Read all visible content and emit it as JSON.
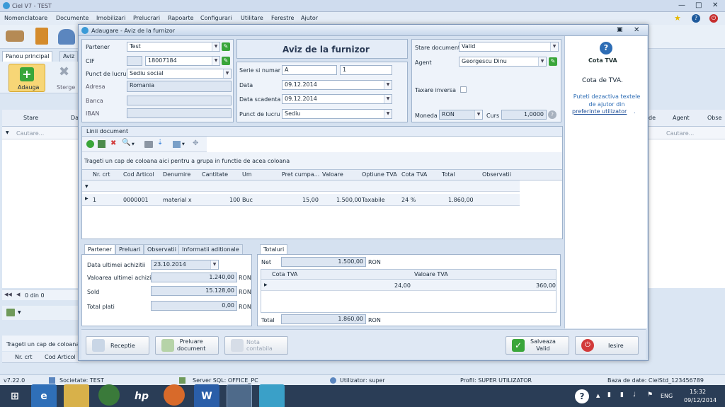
{
  "app": {
    "title": "Ciel V7 - TEST",
    "menu": [
      "Nomenclatoare",
      "Documente",
      "Imobilizari",
      "Prelucrari",
      "Rapoarte",
      "Configurari",
      "Utilitare",
      "Ferestre",
      "Ajutor"
    ]
  },
  "bg": {
    "tabs": [
      "Panou principal",
      "Aviz"
    ],
    "add_label": "Adauga",
    "delete_label": "Sterge",
    "col_stare": "Stare",
    "col_da": "Da",
    "search": "Cautare...",
    "col_agent": "Agent",
    "col_obse": "Obse",
    "search2": "Cautare...",
    "nav": "0 din 0",
    "group_hint": "Trageti un cap de coloana a",
    "col_nr": "Nr. crt",
    "col_cod": "Cod Articol"
  },
  "dialog": {
    "title": "Adaugare - Aviz de la furnizor",
    "heading": "Aviz de la furnizor",
    "partener_label": "Partener",
    "partener": "Test",
    "cif_label": "CIF",
    "cif": "18007184",
    "punct_label": "Punct de lucru",
    "punct": "Sediu social",
    "adresa_label": "Adresa",
    "adresa": "Romania",
    "banca_label": "Banca",
    "iban_label": "IBAN",
    "serie_label": "Serie si numar",
    "serie": "A",
    "numar": "1",
    "data_label": "Data",
    "data": "09.12.2014",
    "scad_label": "Data scadenta",
    "scad": "09.12.2014",
    "punct2_label": "Punct de lucru",
    "punct2": "Sediu",
    "stare_label": "Stare document",
    "stare": "Valid",
    "agent_label": "Agent",
    "agent": "Georgescu Dinu",
    "taxare_label": "Taxare inversa",
    "moneda_label": "Moneda",
    "moneda": "RON",
    "curs_label": "Curs",
    "curs": "1,0000",
    "help_title": "Cota TVA",
    "help_text": "Cota de TVA.",
    "help_note": "Puteti dezactiva textele de ajutor din",
    "help_link": "preferinte utilizator",
    "help_end": ".",
    "lines_tab": "Linii document",
    "group_hint": "Trageti un cap de coloana aici pentru a grupa in functie de acea coloana",
    "columns": [
      "Nr. crt",
      "Cod Articol",
      "Denumire",
      "Cantitate",
      "Um",
      "Pret cumpa...",
      "Valoare",
      "Optiune TVA",
      "Cota TVA",
      "Total",
      "Observatii"
    ],
    "row": [
      "1",
      "0000001",
      "material x",
      "100",
      "Buc",
      "15,00",
      "1.500,00",
      "Taxabile",
      "24 %",
      "1.860,00",
      ""
    ],
    "bottom_tabs": [
      "Partener",
      "Preluari",
      "Observatii",
      "Informatii aditionale"
    ],
    "data_ult_label": "Data ultimei achizitii",
    "data_ult": "23.10.2014",
    "val_ult_label": "Valoarea ultimei achizitii",
    "val_ult": "1.240,00",
    "sold_label": "Sold",
    "sold": "15.128,00",
    "plati_label": "Total plati",
    "plati": "0,00",
    "ron": "RON",
    "totals_tab": "Totaluri",
    "net_label": "Net",
    "net": "1.500,00",
    "cota_col": "Cota TVA",
    "valtva_col": "Valoare TVA",
    "cota_val": "24,00",
    "valtva_val": "360,00",
    "total_label": "Total",
    "total": "1.860,00",
    "btn_receptie": "Receptie",
    "btn_preluare1": "Preluare",
    "btn_preluare2": "document",
    "btn_nota": "Nota contabila",
    "btn_salveaza1": "Salveaza",
    "btn_salveaza2": "Valid",
    "btn_iesire": "Iesire"
  },
  "status": {
    "version": "v7.22.0",
    "societate": "Societate: TEST",
    "server": "Server SQL: OFFICE_PC",
    "user": "Utilizator: super",
    "profil": "Profil: SUPER UTILIZATOR",
    "db": "Baza de date: CielStd_123456789"
  },
  "taskbar": {
    "lang": "ENG",
    "time": "15:32",
    "date": "09/12/2014"
  },
  "colors": {
    "accent": "#3a79c7",
    "green": "#3aa63a",
    "red": "#d23a3a",
    "taskbar": "#2a3d56"
  }
}
